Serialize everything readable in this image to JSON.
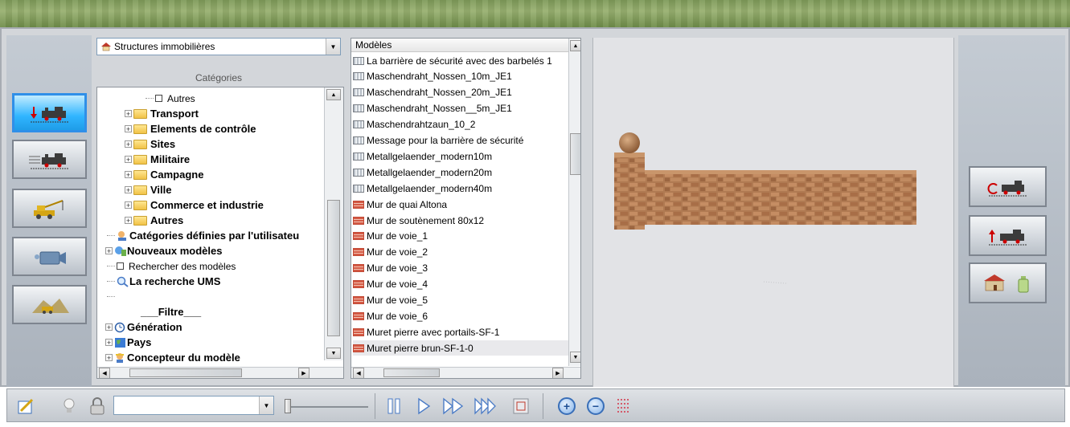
{
  "category_select": {
    "value": "Structures immobilières"
  },
  "categories_label": "Catégories",
  "tree": [
    {
      "label": "Autres",
      "level": "child",
      "kind": "check",
      "bold": false
    },
    {
      "label": "Transport",
      "kind": "folder",
      "bold": true
    },
    {
      "label": "Elements de contrôle",
      "kind": "folder",
      "bold": true
    },
    {
      "label": "Sites",
      "kind": "folder",
      "bold": true
    },
    {
      "label": "Militaire",
      "kind": "folder",
      "bold": true
    },
    {
      "label": "Campagne",
      "kind": "folder",
      "bold": true
    },
    {
      "label": "Ville",
      "kind": "folder",
      "bold": true
    },
    {
      "label": "Commerce et industrie",
      "kind": "folder",
      "bold": true
    },
    {
      "label": "Autres",
      "kind": "folder",
      "bold": true
    },
    {
      "label": "Catégories définies par l'utilisateu",
      "kind": "user",
      "bold": true
    },
    {
      "label": "Nouveaux modèles",
      "kind": "new",
      "bold": true
    },
    {
      "label": "Rechercher des modèles",
      "kind": "check",
      "bold": false
    },
    {
      "label": "La recherche UMS",
      "kind": "search",
      "bold": true
    },
    {
      "label": "",
      "kind": "blank",
      "bold": false
    },
    {
      "label": "___Filtre___",
      "kind": "filter",
      "bold": true
    },
    {
      "label": "Génération",
      "kind": "gen",
      "bold": true
    },
    {
      "label": "Pays",
      "kind": "pays",
      "bold": true
    },
    {
      "label": "Concepteur du modèle",
      "kind": "designer",
      "bold": true
    }
  ],
  "models": {
    "header": "Modèles",
    "items": [
      {
        "label": "La barrière de sécurité avec des barbelés 1",
        "icon": "fence"
      },
      {
        "label": "Maschendraht_Nossen_10m_JE1",
        "icon": "fence"
      },
      {
        "label": "Maschendraht_Nossen_20m_JE1",
        "icon": "fence"
      },
      {
        "label": "Maschendraht_Nossen__5m_JE1",
        "icon": "fence"
      },
      {
        "label": "Maschendrahtzaun_10_2",
        "icon": "fence"
      },
      {
        "label": "Message pour la barrière de sécurité",
        "icon": "fence"
      },
      {
        "label": "Metallgelaender_modern10m",
        "icon": "fence"
      },
      {
        "label": "Metallgelaender_modern20m",
        "icon": "fence"
      },
      {
        "label": "Metallgelaender_modern40m",
        "icon": "fence"
      },
      {
        "label": "Mur de quai Altona",
        "icon": "brick"
      },
      {
        "label": "Mur de soutènement 80x12",
        "icon": "brick"
      },
      {
        "label": "Mur de voie_1",
        "icon": "brick"
      },
      {
        "label": "Mur de voie_2",
        "icon": "brick"
      },
      {
        "label": "Mur de voie_3",
        "icon": "brick"
      },
      {
        "label": "Mur de voie_4",
        "icon": "brick"
      },
      {
        "label": "Mur de voie_5",
        "icon": "brick"
      },
      {
        "label": "Mur de voie_6",
        "icon": "brick"
      },
      {
        "label": "Muret pierre avec portails-SF-1",
        "icon": "brick"
      },
      {
        "label": "Muret pierre brun-SF-1-0",
        "icon": "brick"
      }
    ],
    "selected": "Muret pierre brun-SF-1-0"
  },
  "left_buttons": [
    "insert-train-icon",
    "track-train-icon",
    "crane-icon",
    "camera-icon",
    "landscape-icon"
  ],
  "right_buttons": [
    "rotate-train-icon",
    "lift-train-icon",
    "house-bottle-icon"
  ],
  "toolbar": {
    "speed_value": "",
    "icons": [
      "edit-icon",
      "bulb-icon",
      "lock-icon",
      "pause-icon",
      "play-icon",
      "fast-forward-icon",
      "faster-forward-icon",
      "screenshot-icon",
      "zoom-in-icon",
      "zoom-out-icon",
      "grid-icon"
    ]
  },
  "colors": {
    "active_button": "#2fb0ff",
    "preview_bg": "#e2e3e6"
  }
}
